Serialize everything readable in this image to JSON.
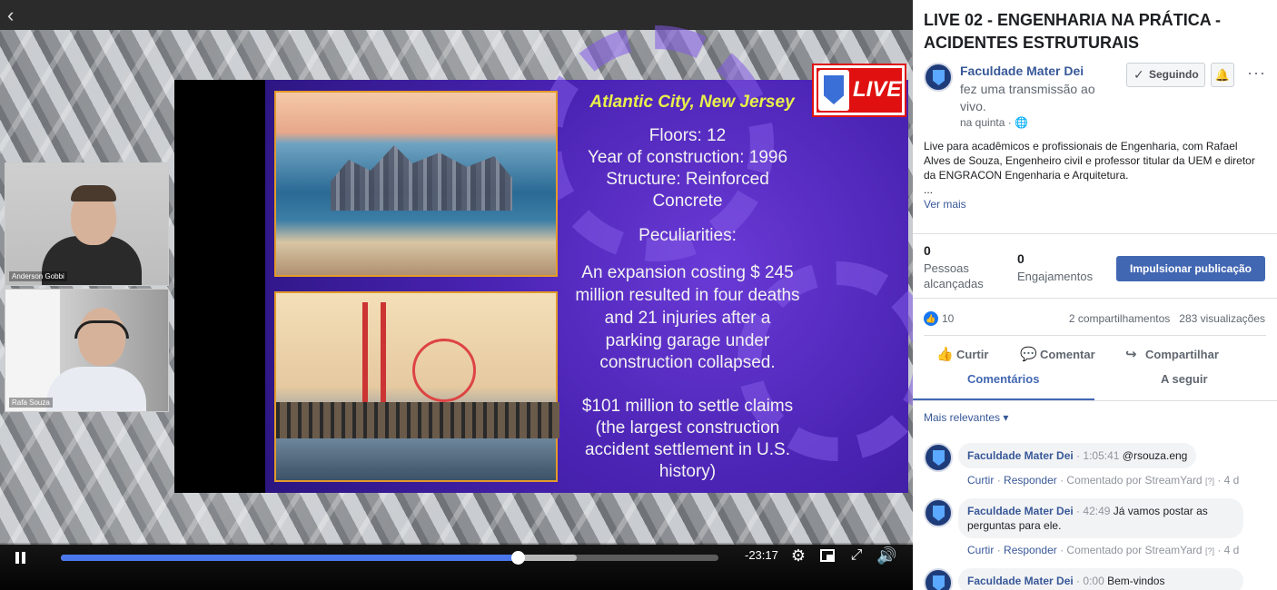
{
  "video": {
    "slide": {
      "title": "Atlantic City, New Jersey",
      "lines": [
        "Floors: 12",
        "Year of construction: 1996",
        "Structure: Reinforced",
        "Concrete",
        "Peculiarities:",
        "An expansion costing $ 245",
        "million resulted in four deaths",
        "and 21 injuries after a",
        "parking garage under",
        "construction collapsed.",
        "$101 million to settle claims",
        "(the largest construction",
        "accident settlement in U.S.",
        "history)"
      ]
    },
    "live_badge": "LIVE",
    "cams": [
      {
        "name": "Anderson Gobbi"
      },
      {
        "name": "Rafa Souza"
      }
    ],
    "time_remaining": "-23:17",
    "progress": 0.695,
    "buffered": 0.785
  },
  "post": {
    "title": "LIVE 02 - ENGENHARIA NA PRÁTICA - ACIDENTES ESTRUTURAIS",
    "page_name": "Faculdade Mater Dei",
    "action_text": "fez uma transmissão ao vivo.",
    "meta": "na quinta · ",
    "follow_label": "Seguindo",
    "more": "···",
    "body": "Live para acadêmicos e profissionais de Engenharia, com Rafael Alves de Souza, Engenheiro civil e professor titular da UEM e diretor da ENGRACON Engenharia e Arquitetura.",
    "ellipsis": "...",
    "see_more": "Ver mais"
  },
  "stats": {
    "reached_num": "0",
    "reached_label": "Pessoas alcançadas",
    "engagements_num": "0",
    "engagements_label": "Engajamentos",
    "boost_label": "Impulsionar publicação",
    "likes": "10",
    "shares_views": "2 compartilhamentos   283 visualizações"
  },
  "actions": {
    "like": "Curtir",
    "comment": "Comentar",
    "share": "Compartilhar"
  },
  "tabs": {
    "comments": "Comentários",
    "following": "A seguir"
  },
  "sort_label": "Mais relevantes ▾",
  "comments": [
    {
      "author": "Faculdade Mater Dei",
      "timestamp": "1:05:41",
      "text": "@rsouza.eng",
      "actions": {
        "like": "Curtir",
        "reply": "Responder",
        "via": "· Comentado por StreamYard",
        "help": "[?]",
        "age": "· 4 d"
      }
    },
    {
      "author": "Faculdade Mater Dei",
      "timestamp": "42:49",
      "text": "Já vamos postar as perguntas para ele.",
      "actions": {
        "like": "Curtir",
        "reply": "Responder",
        "via": "· Comentado por StreamYard",
        "help": "[?]",
        "age": "· 4 d"
      }
    },
    {
      "author": "Faculdade Mater Dei",
      "timestamp": "0:00",
      "text": "Bem-vindos",
      "actions": {
        "like": "",
        "reply": "",
        "via": "",
        "help": "",
        "age": ""
      }
    }
  ],
  "colors": {
    "accent": "#4267b2",
    "link": "#385898",
    "progress": "#4a78ec",
    "live_red": "#e01010"
  }
}
